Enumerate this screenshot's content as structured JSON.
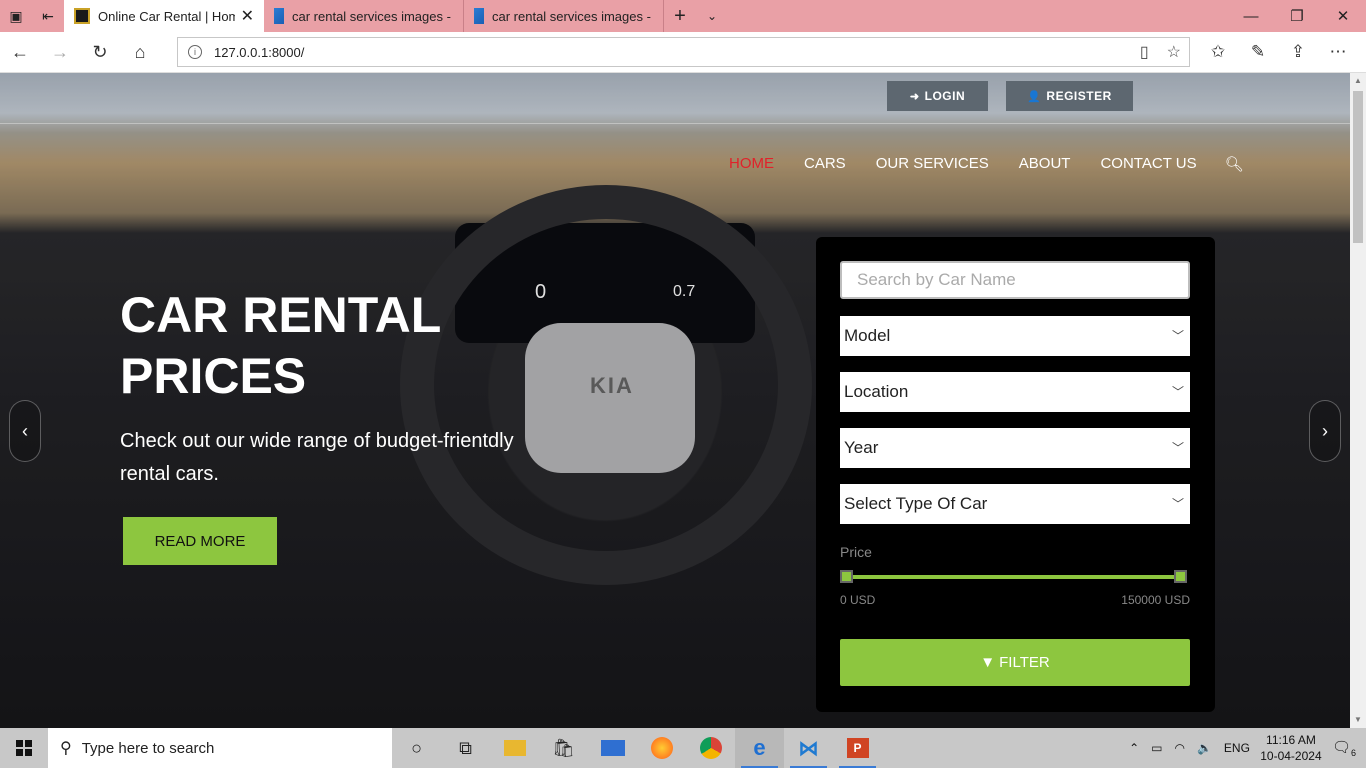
{
  "browser": {
    "tabs": [
      {
        "title": "Online Car Rental | Hom",
        "active": true
      },
      {
        "title": "car rental services images -",
        "active": false
      },
      {
        "title": "car rental services images -",
        "active": false
      }
    ],
    "url": "127.0.0.1:8000/"
  },
  "header": {
    "login_label": "LOGIN",
    "register_label": "REGISTER"
  },
  "menu": {
    "items": [
      "HOME",
      "CARS",
      "OUR SERVICES",
      "ABOUT",
      "CONTACT US"
    ],
    "active": "HOME"
  },
  "hero": {
    "title": "CAR RENTAL PRICES",
    "subtitle": "Check out our wide range of budget-frientdly rental cars.",
    "cta_label": "READ MORE",
    "dashboard": {
      "speed": "0",
      "rpm": "0.7",
      "brand": "KIA"
    }
  },
  "filter": {
    "search_placeholder": "Search by Car Name",
    "model_value": "Model",
    "location_value": "Location",
    "year_value": "Year",
    "type_value": "Select Type Of Car",
    "price_label": "Price",
    "price_min_label": "0 USD",
    "price_max_label": "150000 USD",
    "price_range": {
      "min": 0,
      "max": 150000
    },
    "button_label": "FILTER",
    "accent_color": "#8dc63f"
  },
  "taskbar": {
    "search_placeholder": "Type here to search",
    "language": "ENG",
    "time": "11:16 AM",
    "date": "10-04-2024",
    "notifications": "6"
  }
}
